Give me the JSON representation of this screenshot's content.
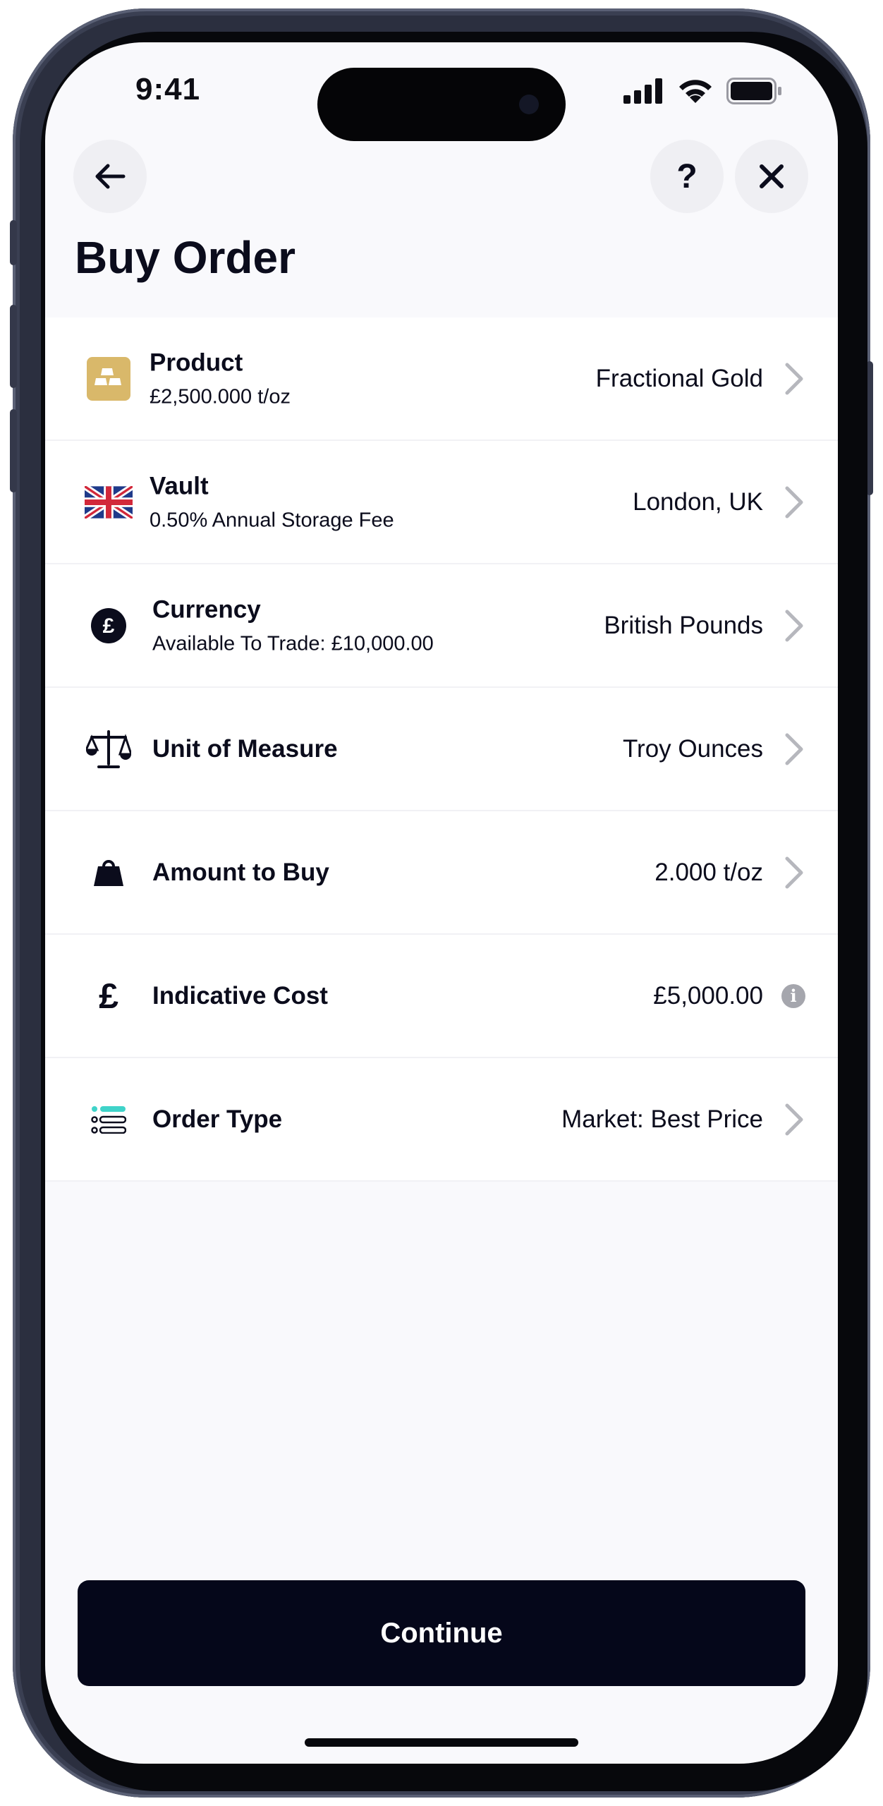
{
  "status_bar": {
    "time": "9:41"
  },
  "header": {
    "title": "Buy Order"
  },
  "rows": [
    {
      "label": "Product",
      "sub": "£2,500.000 t/oz",
      "value": "Fractional Gold",
      "icon": "gold-bar-icon"
    },
    {
      "label": "Vault",
      "sub": "0.50% Annual Storage Fee",
      "value": "London, UK",
      "icon": "uk-flag-icon"
    },
    {
      "label": "Currency",
      "sub": "Available To Trade: £10,000.00",
      "value": "British Pounds",
      "icon": "pound-coin-icon"
    },
    {
      "label": "Unit of Measure",
      "value": "Troy Ounces",
      "icon": "scales-icon"
    },
    {
      "label": "Amount to Buy",
      "value": "2.000 t/oz",
      "icon": "weight-icon"
    },
    {
      "label": "Indicative Cost",
      "value": "£5,000.00",
      "icon": "pound-icon",
      "info_glyph": "i"
    },
    {
      "label": "Order Type",
      "value": "Market: Best Price",
      "icon": "list-icon"
    }
  ],
  "footer": {
    "continue_label": "Continue"
  },
  "colors": {
    "gold": "#d9b86a",
    "navy": "#05071a",
    "teal": "#3fd3c9",
    "background": "#f9f9fc"
  }
}
